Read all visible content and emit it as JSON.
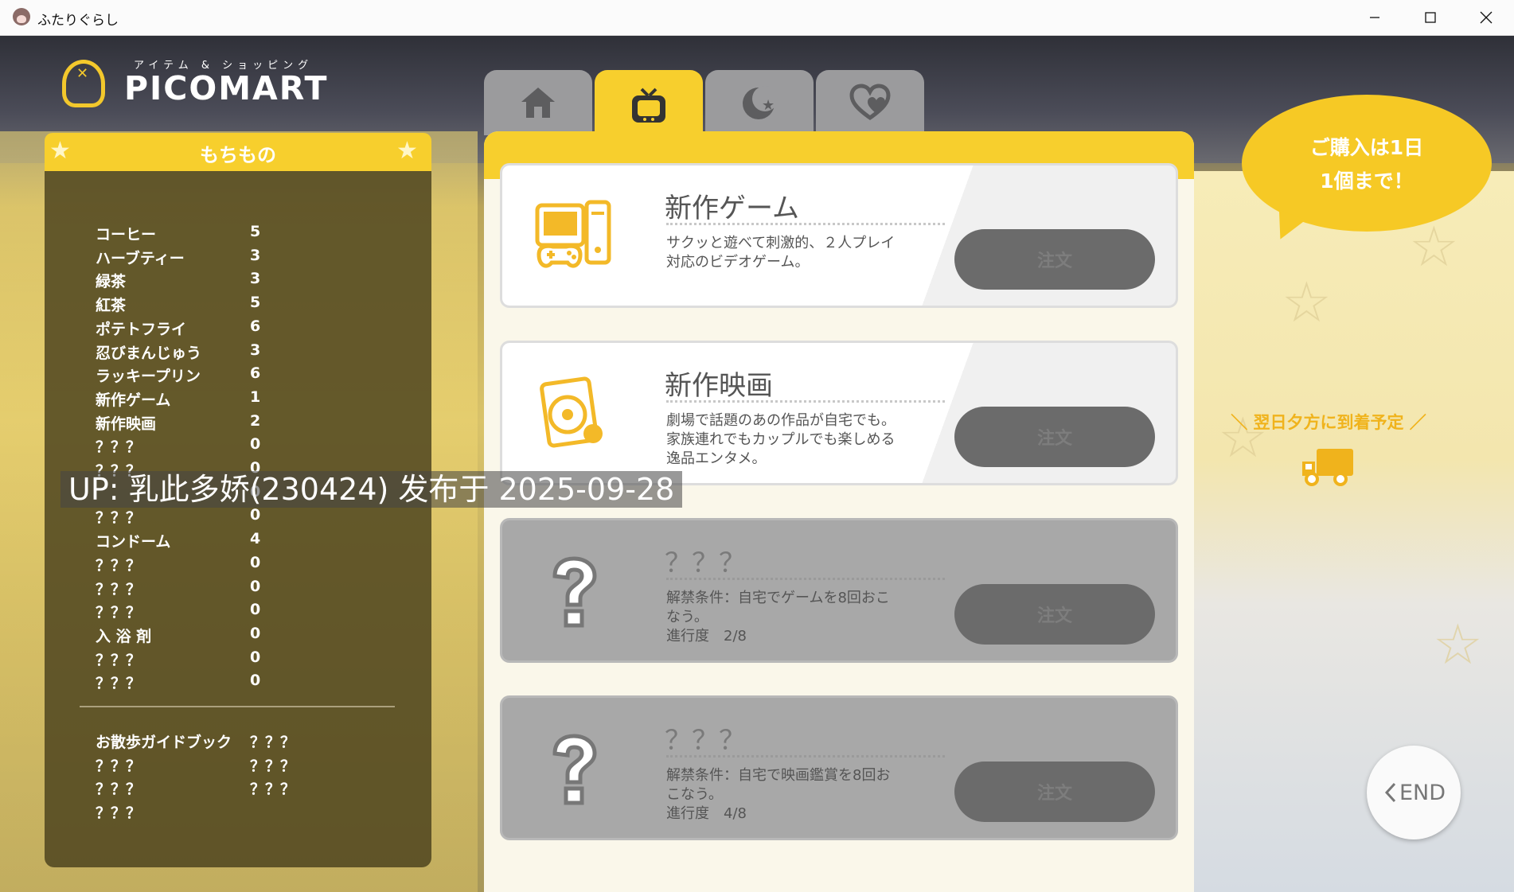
{
  "window": {
    "title": "ふたりぐらし",
    "min_icon": "minimize-icon",
    "max_icon": "maximize-icon",
    "close_icon": "close-icon"
  },
  "logo": {
    "subtitle": "アイテム & ショッピング",
    "name": "PICOMART"
  },
  "inventory": {
    "title": "もちもの",
    "items": [
      {
        "name": "コーヒー",
        "count": "5"
      },
      {
        "name": "ハーブティー",
        "count": "3"
      },
      {
        "name": "緑茶",
        "count": "3"
      },
      {
        "name": "紅茶",
        "count": "5"
      },
      {
        "name": "ポテトフライ",
        "count": "6"
      },
      {
        "name": "忍びまんじゅう",
        "count": "3"
      },
      {
        "name": "ラッキープリン",
        "count": "6"
      },
      {
        "name": "新作ゲーム",
        "count": "1"
      },
      {
        "name": "新作映画",
        "count": "2"
      },
      {
        "name": "？？？",
        "count": "0"
      },
      {
        "name": "？？？",
        "count": "0"
      },
      {
        "name": "",
        "count": "0"
      },
      {
        "name": "？？？",
        "count": "0"
      },
      {
        "name": "コンドーム",
        "count": "4"
      },
      {
        "name": "？？？",
        "count": "0"
      },
      {
        "name": "？？？",
        "count": "0"
      },
      {
        "name": "？？？",
        "count": "0"
      },
      {
        "name": "入 浴 剤",
        "count": "0"
      },
      {
        "name": "？？？",
        "count": "0"
      },
      {
        "name": "？？？",
        "count": "0"
      }
    ],
    "guides": [
      {
        "left": "お散歩ガイドブック",
        "right": "？？？"
      },
      {
        "left": "？？？",
        "right": "？？？"
      },
      {
        "left": "？？？",
        "right": "？？？"
      },
      {
        "left": "？？？",
        "right": ""
      }
    ]
  },
  "tabs": [
    {
      "icon": "home-icon"
    },
    {
      "icon": "tv-icon",
      "active": true
    },
    {
      "icon": "moon-star-icon"
    },
    {
      "icon": "heart-icon"
    }
  ],
  "shop": {
    "items": [
      {
        "name": "新作ゲーム",
        "desc": "サクッと遊べて刺激的、２人プレイ対応のビデオゲーム。",
        "button": "注文",
        "icon": "computer-game-icon",
        "locked": false
      },
      {
        "name": "新作映画",
        "desc": "劇場で話題のあの作品が自宅でも。家族連れでもカップルでも楽しめる逸品エンタメ。",
        "button": "注文",
        "icon": "movie-disc-icon",
        "locked": false
      },
      {
        "name": "？？？",
        "desc": "解禁条件：自宅でゲームを8回おこなう。",
        "progress": "進行度　2/8",
        "button": "注文",
        "icon": "question-mark-icon",
        "locked": true
      },
      {
        "name": "？？？",
        "desc": "解禁条件：自宅で映画鑑賞を8回おこなう。",
        "progress": "進行度　4/8",
        "button": "注文",
        "icon": "question-mark-icon",
        "locked": true
      }
    ]
  },
  "notice": {
    "line1": "ご購入は1日",
    "line2": "1個まで！"
  },
  "arrival": {
    "text": "＼ 翌日夕方に到着予定 ／",
    "icon": "truck-icon"
  },
  "end_button": {
    "label": "END",
    "icon": "chevron-left-icon"
  },
  "overlay": {
    "text": "UP: 乳此多娇(230424) 发布于 2025-09-28"
  }
}
